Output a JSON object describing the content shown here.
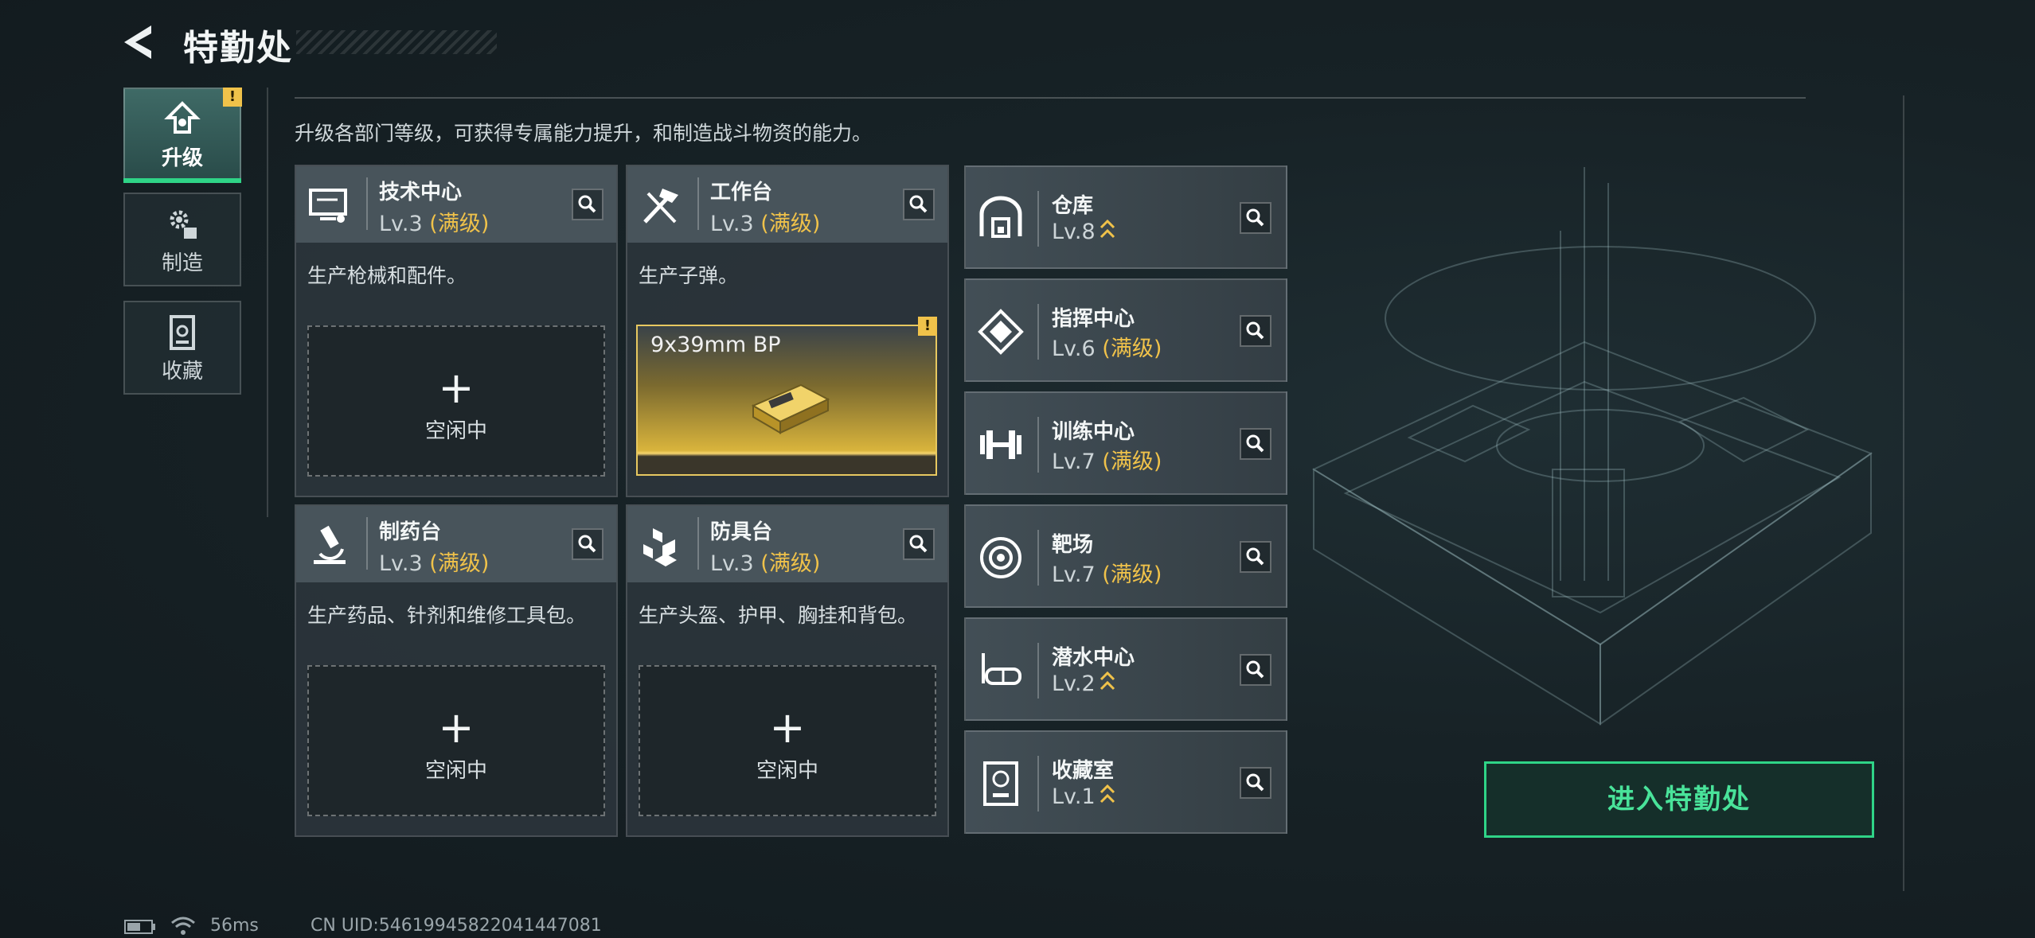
{
  "header": {
    "title": "特勤处"
  },
  "tabs": [
    {
      "label": "升级",
      "icon": "upgrade-icon",
      "active": true,
      "alert": "!"
    },
    {
      "label": "制造",
      "icon": "gears-icon",
      "active": false
    },
    {
      "label": "收藏",
      "icon": "collection-icon",
      "active": false
    }
  ],
  "description": "升级各部门等级，可获得专属能力提升，和制造战斗物资的能力。",
  "departments": [
    {
      "name": "技术中心",
      "level": "Lv.3",
      "max": "(满级)",
      "desc": "生产枪械和配件。",
      "slot": "空闲中",
      "icon": "tech-center-icon"
    },
    {
      "name": "工作台",
      "level": "Lv.3",
      "max": "(满级)",
      "desc": "生产子弹。",
      "product": "9x39mm BP",
      "alert": "!",
      "icon": "workbench-icon"
    },
    {
      "name": "制药台",
      "level": "Lv.3",
      "max": "(满级)",
      "desc": "生产药品、针剂和维修工具包。",
      "slot": "空闲中",
      "icon": "microscope-icon"
    },
    {
      "name": "防具台",
      "level": "Lv.3",
      "max": "(满级)",
      "desc": "生产头盔、护甲、胸挂和背包。",
      "slot": "空闲中",
      "icon": "armor-bench-icon"
    }
  ],
  "facilities": [
    {
      "name": "仓库",
      "level": "Lv.8",
      "max": "",
      "upgradable": true,
      "icon": "warehouse-icon"
    },
    {
      "name": "指挥中心",
      "level": "Lv.6",
      "max": "(满级)",
      "upgradable": false,
      "icon": "command-center-icon"
    },
    {
      "name": "训练中心",
      "level": "Lv.7",
      "max": "(满级)",
      "upgradable": false,
      "icon": "dumbbell-icon"
    },
    {
      "name": "靶场",
      "level": "Lv.7",
      "max": "(满级)",
      "upgradable": false,
      "icon": "target-icon"
    },
    {
      "name": "潜水中心",
      "level": "Lv.2",
      "max": "",
      "upgradable": true,
      "icon": "dive-mask-icon"
    },
    {
      "name": "收藏室",
      "level": "Lv.1",
      "max": "",
      "upgradable": true,
      "icon": "trophy-room-icon"
    }
  ],
  "enter_button": "进入特勤处",
  "footer": {
    "ping": "56ms",
    "uid": "CN UID:5461994582204144708​1"
  },
  "colors": {
    "accent": "#2fd487",
    "max_level": "#f0c24a",
    "alert": "#f0c24a"
  }
}
